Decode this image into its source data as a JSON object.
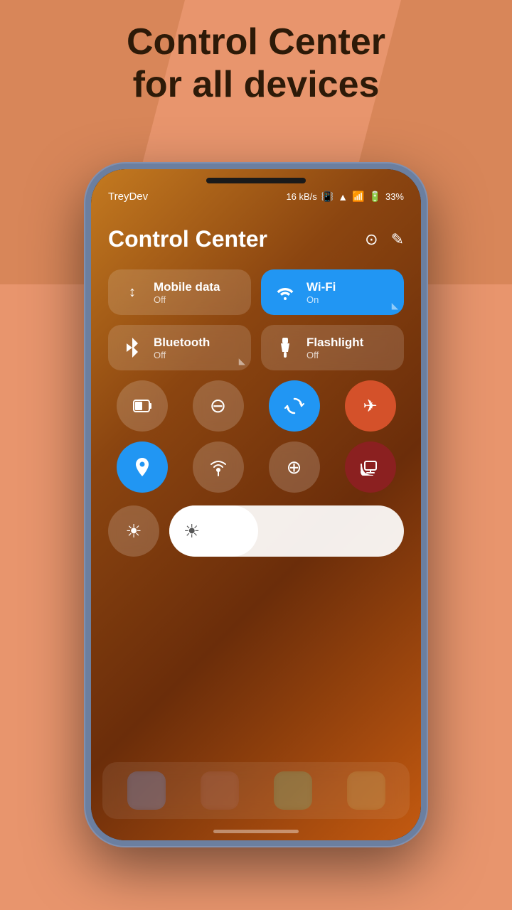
{
  "headline": {
    "line1": "Control Center",
    "line2": "for all devices"
  },
  "status_bar": {
    "carrier": "TreyDev",
    "speed": "16 kB/s",
    "battery": "33%"
  },
  "control_center": {
    "title": "Control Center",
    "settings_icon": "⊙",
    "edit_icon": "✎",
    "toggles": [
      {
        "id": "mobile-data",
        "name": "Mobile data",
        "status": "Off",
        "icon": "↕",
        "active": false
      },
      {
        "id": "wifi",
        "name": "Wi-Fi",
        "status": "On",
        "icon": "📶",
        "active": true
      },
      {
        "id": "bluetooth",
        "name": "Bluetooth",
        "status": "Off",
        "icon": "✱",
        "active": false
      },
      {
        "id": "flashlight",
        "name": "Flashlight",
        "status": "Off",
        "icon": "🔦",
        "active": false
      }
    ],
    "icon_row1": [
      {
        "id": "battery-saver",
        "icon": "🔋",
        "active": false,
        "type": "normal"
      },
      {
        "id": "dnd",
        "icon": "⊖",
        "active": false,
        "type": "normal"
      },
      {
        "id": "auto-rotate",
        "icon": "↻",
        "active": true,
        "type": "blue"
      },
      {
        "id": "airplane",
        "icon": "✈",
        "active": true,
        "type": "orange"
      }
    ],
    "icon_row2": [
      {
        "id": "location",
        "icon": "📍",
        "active": true,
        "type": "blue"
      },
      {
        "id": "hotspot",
        "icon": "📡",
        "active": false,
        "type": "normal"
      },
      {
        "id": "nfc",
        "icon": "⊕",
        "active": false,
        "type": "normal"
      },
      {
        "id": "cast",
        "icon": "📺",
        "active": true,
        "type": "red-dark"
      }
    ],
    "brightness": {
      "icon": "☀",
      "level": 38
    }
  }
}
